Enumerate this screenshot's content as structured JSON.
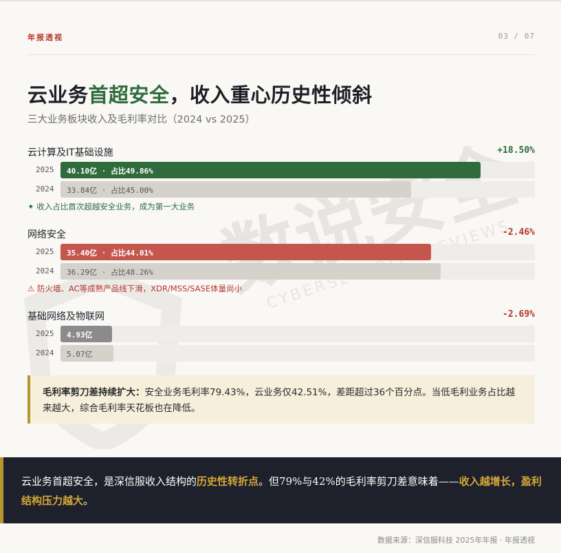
{
  "header": {
    "brand": "年报透视",
    "pager": "03 / 07"
  },
  "title": {
    "part1": "云业务",
    "accent": "首超安全",
    "part2": "，收入重心历史性倾斜"
  },
  "subtitle": "三大业务板块收入及毛利率对比（2024 vs 2025）",
  "sections": [
    {
      "label": "云计算及IT基础设施",
      "change": "+18.50%",
      "rows": [
        {
          "year": "2025",
          "text": "40.10亿 · 占比49.86%",
          "fraction": 0.885
        },
        {
          "year": "2024",
          "text": "33.84亿 · 占比45.00%",
          "fraction": 0.739
        }
      ],
      "note": "✦ 收入占比首次超越安全业务，成为第一大业务"
    },
    {
      "label": "网络安全",
      "change": "-2.46%",
      "rows": [
        {
          "year": "2025",
          "text": "35.40亿 · 占比44.01%",
          "fraction": 0.781
        },
        {
          "year": "2024",
          "text": "36.29亿 · 占比48.26%",
          "fraction": 0.801
        }
      ],
      "note": "⚠ 防火墙、AC等成熟产品线下滑，XDR/MSS/SASE体量尚小"
    },
    {
      "label": "基础网络及物联网",
      "change": "-2.69%",
      "rows": [
        {
          "year": "2025",
          "text": "4.93亿",
          "fraction": 0.109
        },
        {
          "year": "2024",
          "text": "5.07亿",
          "fraction": 0.112
        }
      ]
    }
  ],
  "callout": {
    "bold": "毛利率剪刀差持续扩大：",
    "text": "安全业务毛利率79.43%，云业务仅42.51%，差距超过36个百分点。当低毛利业务占比越来越大，综合毛利率天花板也在降低。"
  },
  "banner": {
    "t1": "云业务首超安全，是深信服收入结构的",
    "h1": "历史性转折点",
    "t2": "。但79%与42%的毛利率剪刀差意味着——",
    "h2": "收入越增长，盈利结构压力越大",
    "t3": "。"
  },
  "footer": "数据来源：深信服科技 2025年年报 · 年报透视",
  "watermark": {
    "big": "数说安全",
    "small": "CYBERSECURITY REVIEWS"
  },
  "colors": {
    "green": "#2f6b3c",
    "red": "#c4564e",
    "gold": "#b8962e",
    "navy": "#1e202b"
  }
}
